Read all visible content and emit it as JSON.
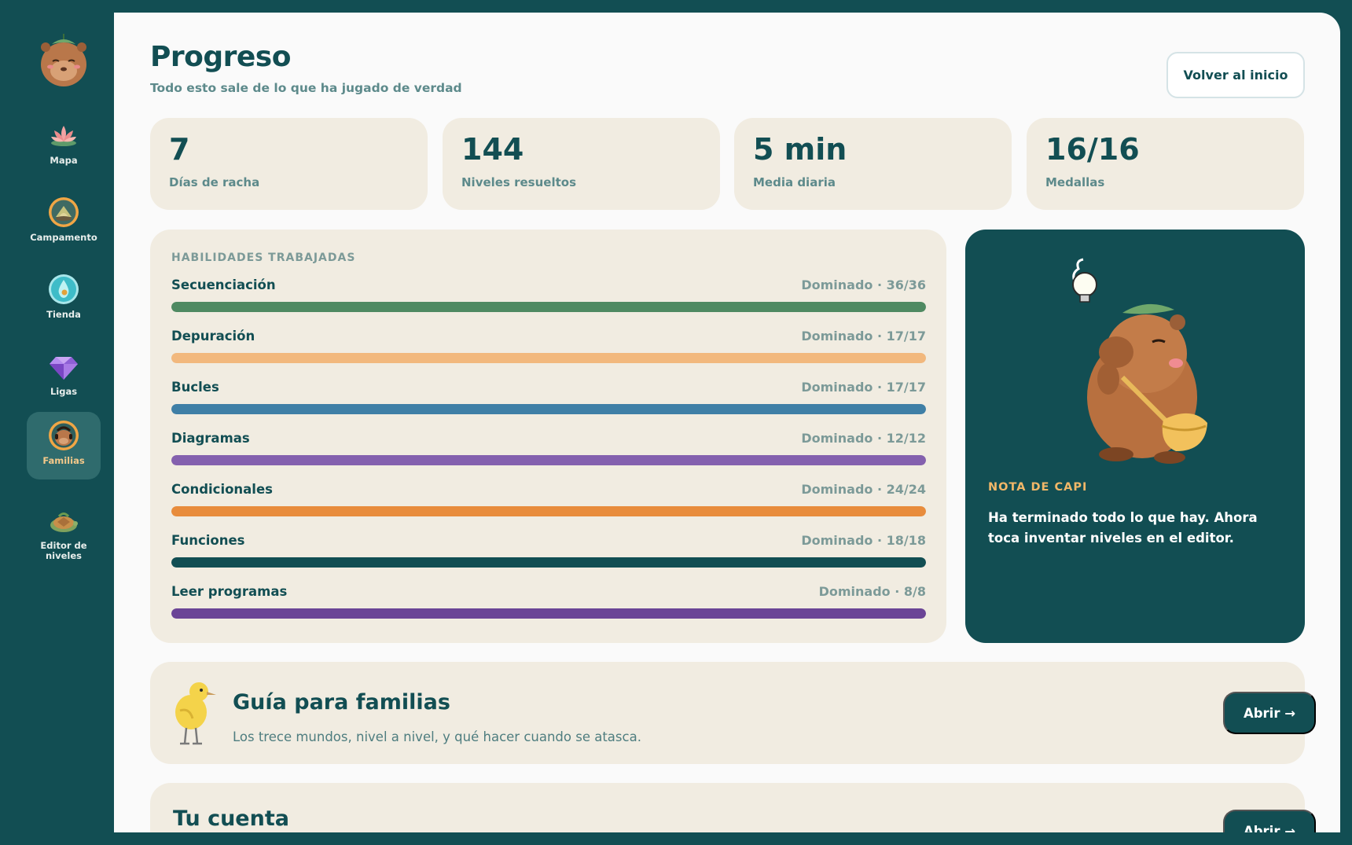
{
  "sidebar": {
    "items": [
      {
        "label": "Mapa",
        "icon": "lotus-icon"
      },
      {
        "label": "Campamento",
        "icon": "campfire-icon"
      },
      {
        "label": "Tienda",
        "icon": "water-drop-icon"
      },
      {
        "label": "Ligas",
        "icon": "gem-icon"
      },
      {
        "label": "Familias",
        "icon": "family-capybara-icon",
        "active": true
      },
      {
        "label": "Editor de niveles",
        "icon": "turtle-editor-icon"
      }
    ]
  },
  "header": {
    "title": "Progreso",
    "subtitle": "Todo esto sale de lo que ha jugado de verdad",
    "back_label": "Volver al inicio"
  },
  "stats": [
    {
      "value": "7",
      "label": "Días de racha"
    },
    {
      "value": "144",
      "label": "Niveles resueltos"
    },
    {
      "value": "5 min",
      "label": "Media diaria"
    },
    {
      "value": "16/16",
      "label": "Medallas"
    }
  ],
  "skills": {
    "heading": "HABILIDADES TRABAJADAS",
    "items": [
      {
        "name": "Secuenciación",
        "status": "Dominado · 36/36",
        "progress": 1.0,
        "color": "#4f8a62"
      },
      {
        "name": "Depuración",
        "status": "Dominado · 17/17",
        "progress": 1.0,
        "color": "#f2b87d"
      },
      {
        "name": "Bucles",
        "status": "Dominado · 17/17",
        "progress": 1.0,
        "color": "#3f7fa6"
      },
      {
        "name": "Diagramas",
        "status": "Dominado · 12/12",
        "progress": 1.0,
        "color": "#8460ae"
      },
      {
        "name": "Condicionales",
        "status": "Dominado · 24/24",
        "progress": 1.0,
        "color": "#e88c3c"
      },
      {
        "name": "Funciones",
        "status": "Dominado · 18/18",
        "progress": 1.0,
        "color": "#124e53"
      },
      {
        "name": "Leer programas",
        "status": "Dominado · 8/8",
        "progress": 1.0,
        "color": "#6b4496"
      }
    ]
  },
  "note": {
    "heading": "NOTA DE CAPI",
    "text": "Ha terminado todo lo que hay. Ahora toca inventar niveles en el editor."
  },
  "guide": {
    "title": "Guía para familias",
    "description": "Los trece mundos, nivel a nivel, y qué hacer cuando se atasca.",
    "open_label": "Abrir →"
  },
  "account": {
    "title": "Tu cuenta",
    "open_label": "Abrir →"
  }
}
